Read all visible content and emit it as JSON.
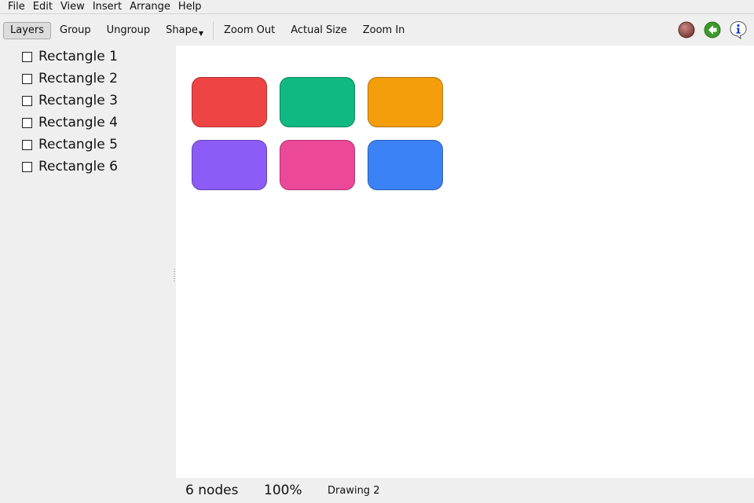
{
  "menubar": {
    "items": [
      "File",
      "Edit",
      "View",
      "Insert",
      "Arrange",
      "Help"
    ]
  },
  "toolbar": {
    "layers_label": "Layers",
    "group_label": "Group",
    "ungroup_label": "Ungroup",
    "shape_label": "Shape",
    "zoom_out_label": "Zoom Out",
    "actual_size_label": "Actual Size",
    "zoom_in_label": "Zoom In",
    "layers_active": true
  },
  "layers": [
    {
      "label": "Rectangle 1",
      "checked": false
    },
    {
      "label": "Rectangle 2",
      "checked": false
    },
    {
      "label": "Rectangle 3",
      "checked": false
    },
    {
      "label": "Rectangle 4",
      "checked": false
    },
    {
      "label": "Rectangle 5",
      "checked": false
    },
    {
      "label": "Rectangle 6",
      "checked": false
    }
  ],
  "canvas": {
    "shapes": [
      {
        "name": "Rectangle 1",
        "color": "#ef4444"
      },
      {
        "name": "Rectangle 2",
        "color": "#10b981"
      },
      {
        "name": "Rectangle 3",
        "color": "#f59e0b"
      },
      {
        "name": "Rectangle 4",
        "color": "#8b5cf6"
      },
      {
        "name": "Rectangle 5",
        "color": "#ec4899"
      },
      {
        "name": "Rectangle 6",
        "color": "#3b82f6"
      }
    ]
  },
  "status": {
    "nodes": "6 nodes",
    "zoom": "100%",
    "document": "Drawing 2"
  },
  "icons": {
    "record": "record-icon",
    "back": "back-arrow-icon",
    "info": "info-icon"
  }
}
